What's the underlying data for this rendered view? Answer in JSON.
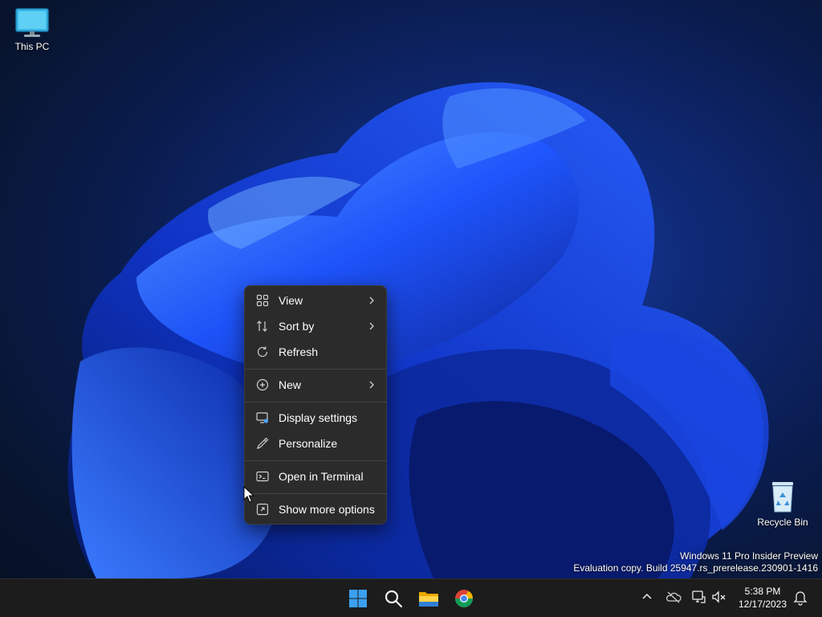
{
  "desktop": {
    "icons": [
      {
        "label": "This PC"
      },
      {
        "label": "Recycle Bin"
      }
    ]
  },
  "context_menu": {
    "items": [
      {
        "label": "View",
        "icon": "grid-icon",
        "submenu": true
      },
      {
        "label": "Sort by",
        "icon": "sort-icon",
        "submenu": true
      },
      {
        "label": "Refresh",
        "icon": "refresh-icon",
        "submenu": false
      },
      {
        "label": "New",
        "icon": "plus-circle-icon",
        "submenu": true
      },
      {
        "label": "Display settings",
        "icon": "display-settings-icon",
        "submenu": false
      },
      {
        "label": "Personalize",
        "icon": "pen-icon",
        "submenu": false
      },
      {
        "label": "Open in Terminal",
        "icon": "terminal-icon",
        "submenu": false
      },
      {
        "label": "Show more options",
        "icon": "expand-icon",
        "submenu": false
      }
    ]
  },
  "watermark": {
    "line1": "Windows 11 Pro Insider Preview",
    "line2": "Evaluation copy. Build 25947.rs_prerelease.230901-1416"
  },
  "taskbar": {
    "apps": [
      "start-icon",
      "search-icon",
      "file-explorer-icon",
      "chrome-icon"
    ],
    "tray": [
      "chevron-up-icon",
      "onedrive-offline-icon",
      "network-icon",
      "volume-muted-icon",
      "notifications-icon"
    ],
    "time": "5:38 PM",
    "date": "12/17/2023"
  },
  "colors": {
    "accent": "#0078d4",
    "menu_bg": "#2b2b2b",
    "taskbar_bg": "#1c1c1c",
    "wallpaper_blue": "#1e5bff"
  }
}
